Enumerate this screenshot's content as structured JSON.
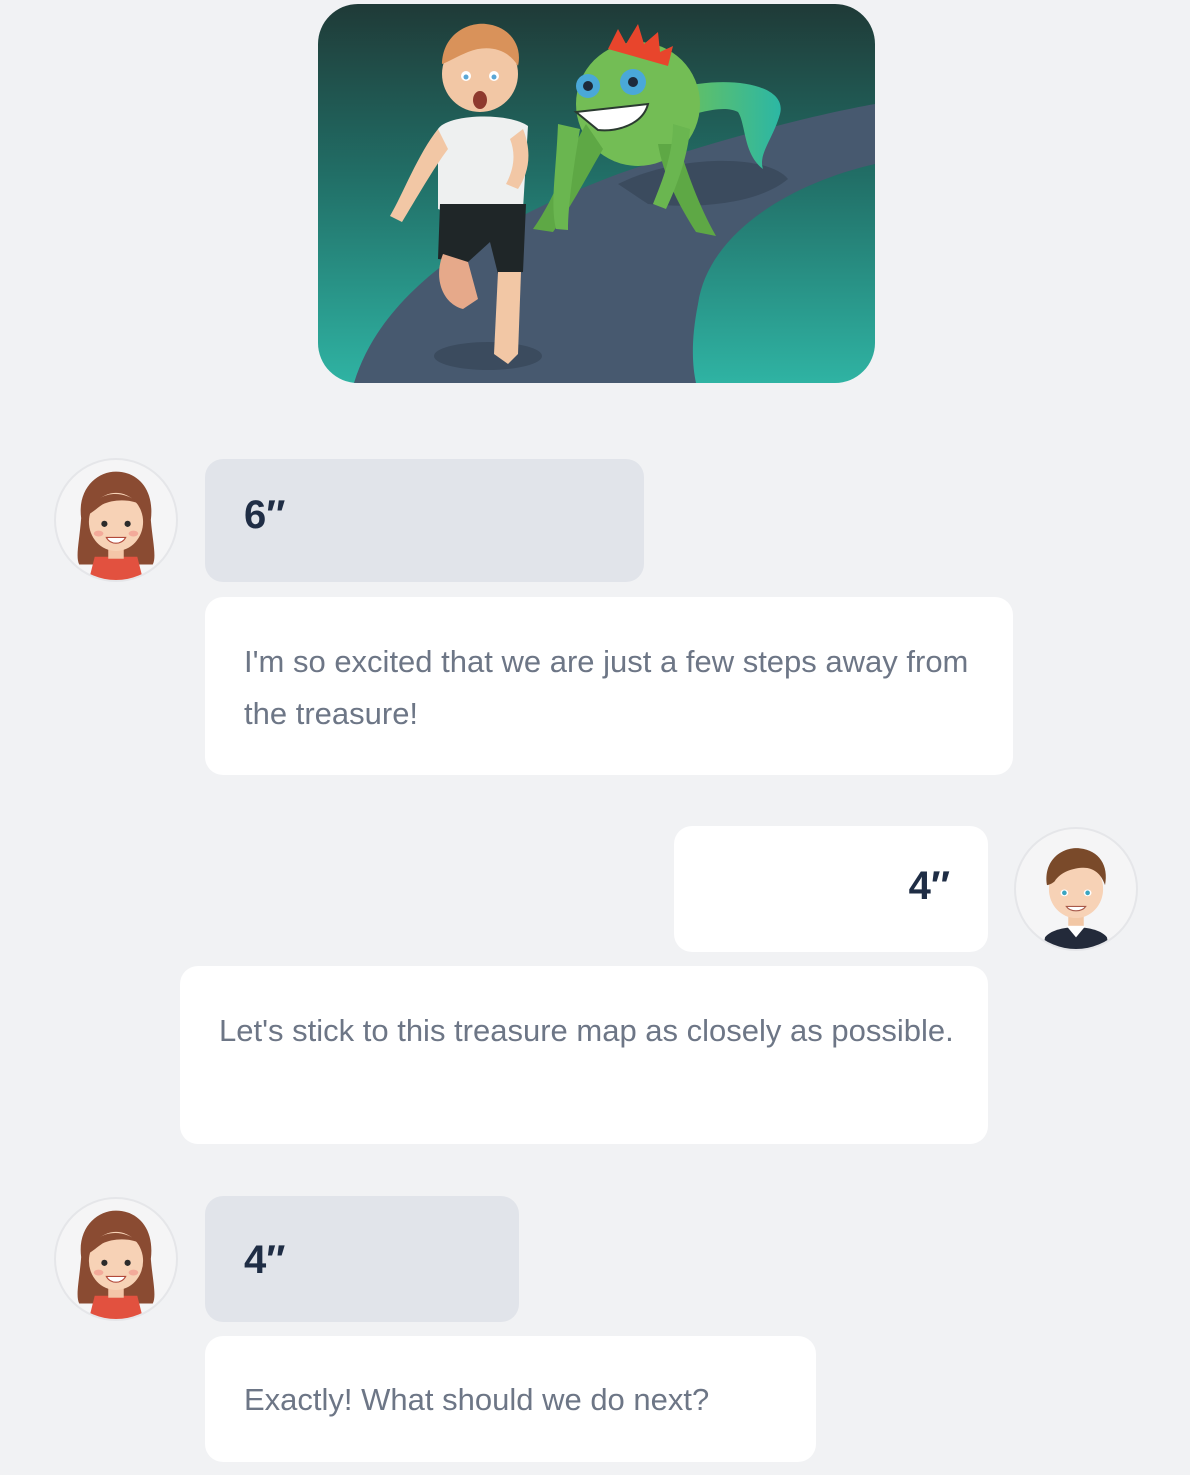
{
  "scene": {
    "icon": "story-illustration-boy-chased-by-monster"
  },
  "messages": [
    {
      "speaker": "girl",
      "duration": "6″"
    },
    {
      "speaker": "girl",
      "text": "I'm so excited that we are just a few steps away from the treasure!"
    },
    {
      "speaker": "boy",
      "duration": "4″"
    },
    {
      "speaker": "boy",
      "text": "Let's stick to this treasure map as closely as possible."
    },
    {
      "speaker": "girl",
      "duration": "4″"
    },
    {
      "speaker": "girl",
      "text": "Exactly! What should we do next?"
    }
  ],
  "avatars": {
    "girl_icon": "girl-avatar-icon",
    "boy_icon": "boy-avatar-icon"
  },
  "colors": {
    "background": "#f1f2f4",
    "bubble_grey": "#e1e4ea",
    "bubble_white": "#ffffff",
    "duration_text": "#1f2d45",
    "message_text": "#6d7686"
  }
}
